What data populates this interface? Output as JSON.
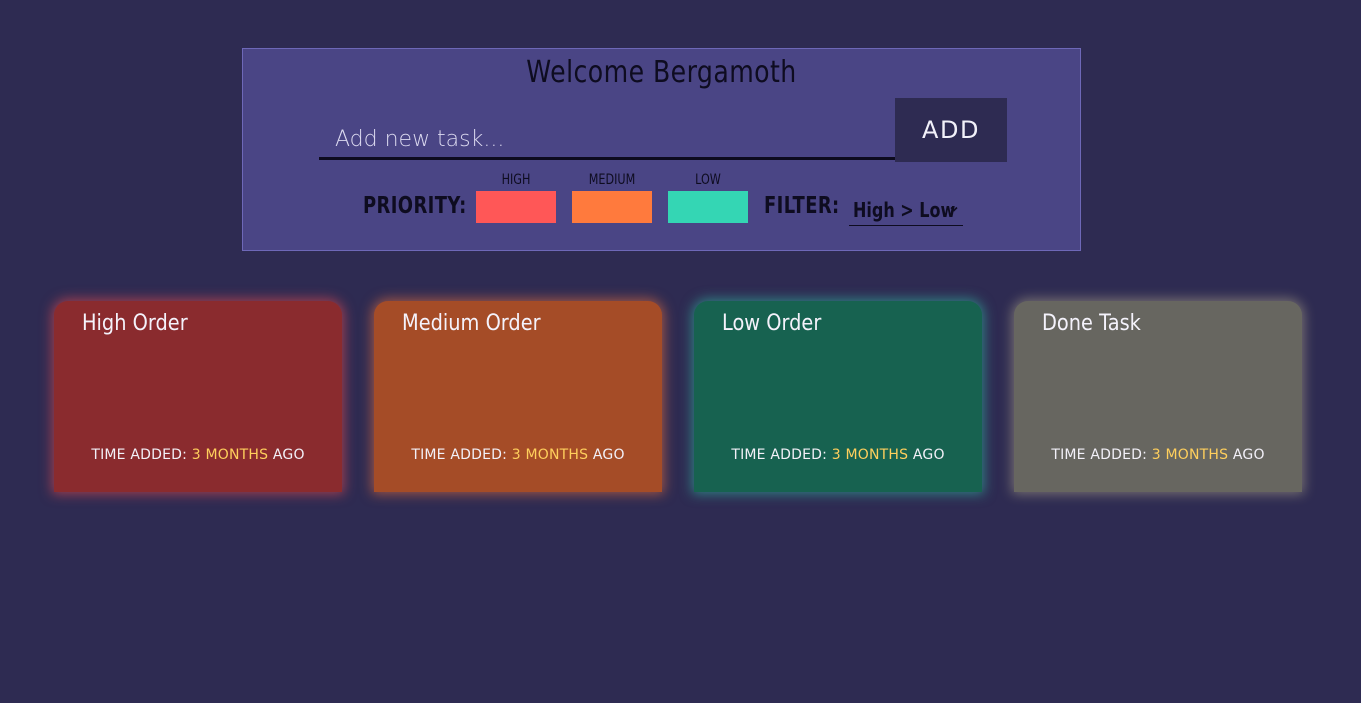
{
  "header": {
    "welcome": "Welcome Bergamoth"
  },
  "task_form": {
    "input_placeholder": "Add new task...",
    "input_value": "",
    "add_label": "ADD"
  },
  "priority": {
    "label": "PRIORITY:",
    "options": [
      {
        "caption": "HIGH",
        "color": "#ff5757"
      },
      {
        "caption": "MEDIUM",
        "color": "#ff7a3d"
      },
      {
        "caption": "LOW",
        "color": "#34d6b4"
      }
    ]
  },
  "filter": {
    "label": "FILTER:",
    "selected": "High > Low",
    "icon": "chevron-down-icon"
  },
  "cards": [
    {
      "title": "High Order",
      "time_prefix": "TIME ADDED:",
      "time_value": "3 MONTHS",
      "time_suffix": "AGO",
      "color": "#8a2b2e"
    },
    {
      "title": "Medium Order",
      "time_prefix": "TIME ADDED:",
      "time_value": "3 MONTHS",
      "time_suffix": "AGO",
      "color": "#a54c27"
    },
    {
      "title": "Low Order",
      "time_prefix": "TIME ADDED:",
      "time_value": "3 MONTHS",
      "time_suffix": "AGO",
      "color": "#176250"
    },
    {
      "title": "Done Task",
      "time_prefix": "TIME ADDED:",
      "time_value": "3 MONTHS",
      "time_suffix": "AGO",
      "color": "#676660"
    }
  ],
  "colors": {
    "background": "#2e2b52",
    "panel": "#4a4585",
    "highlight": "#ffcf5c"
  }
}
